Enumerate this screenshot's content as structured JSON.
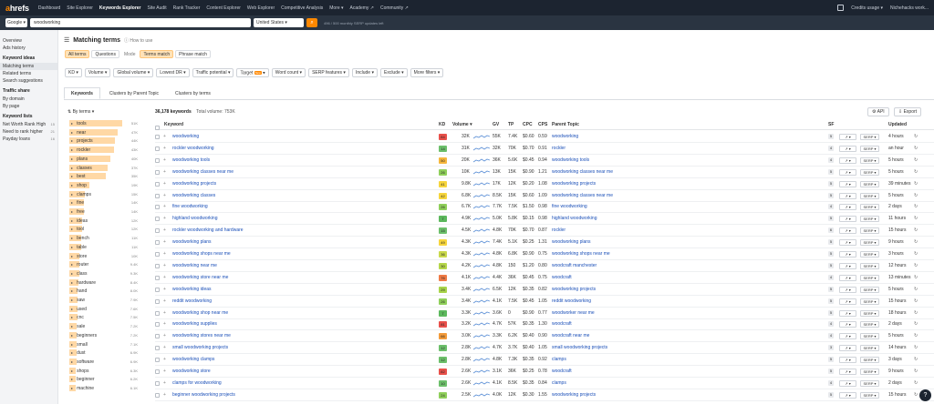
{
  "topnav": {
    "logo": "ahrefs",
    "items": [
      "Dashboard",
      "Site Explorer",
      "Keywords Explorer",
      "Site Audit",
      "Rank Tracker",
      "Content Explorer",
      "Web Explorer",
      "Competitive Analysis",
      "More ▾",
      "Academy ↗",
      "Community ↗"
    ],
    "credits": "Credits usage ▾",
    "account": "Nichehacks work..."
  },
  "search": {
    "engine": "Google ▾",
    "keyword": "woodworking",
    "country": "United States ▾",
    "quota": "496 / 500 monthly SERP updates left"
  },
  "sidebar": {
    "top": [
      {
        "label": "Overview"
      },
      {
        "label": "Ads history"
      }
    ],
    "keyword_ideas_head": "Keyword ideas",
    "keyword_ideas": [
      {
        "label": "Matching terms"
      },
      {
        "label": "Related terms"
      },
      {
        "label": "Search suggestions"
      }
    ],
    "traffic_head": "Traffic share",
    "traffic": [
      {
        "label": "By domain"
      },
      {
        "label": "By page"
      }
    ],
    "lists_head": "Keyword lists",
    "lists": [
      {
        "label": "Net Worth Rank High",
        "count": "15"
      },
      {
        "label": "Need to rank higher",
        "count": "21"
      },
      {
        "label": "Payday loans",
        "count": "16"
      }
    ]
  },
  "main": {
    "title": "Matching terms",
    "how_to": "How to use",
    "modes_left": [
      "All terms",
      "Questions"
    ],
    "mode_label": "Mode",
    "modes_right": [
      "Terms match",
      "Phrase match"
    ],
    "filters": [
      "KD ▾",
      "Volume ▾",
      "Global volume ▾",
      "Lowest DR ▾",
      "Traffic potential ▾",
      "Target",
      "Word count ▾",
      "SERP features ▾",
      "Include ▾",
      "Exclude ▾",
      "More filters ▾"
    ],
    "target_badge": "New",
    "target_arrow": "▾",
    "tabs": [
      "Keywords",
      "Clusters by Parent Topic",
      "Clusters by terms"
    ]
  },
  "terms": {
    "head": "By terms ▾",
    "items": [
      {
        "t": "tools",
        "c": "51K",
        "v": 51
      },
      {
        "t": "near",
        "c": "47K",
        "v": 47
      },
      {
        "t": "projects",
        "c": "44K",
        "v": 44
      },
      {
        "t": "rockler",
        "c": "43K",
        "v": 43
      },
      {
        "t": "plans",
        "c": "40K",
        "v": 40
      },
      {
        "t": "classes",
        "c": "37K",
        "v": 37
      },
      {
        "t": "best",
        "c": "35K",
        "v": 35
      },
      {
        "t": "shop",
        "c": "19K",
        "v": 19
      },
      {
        "t": "clamps",
        "c": "15K",
        "v": 15
      },
      {
        "t": "fine",
        "c": "14K",
        "v": 14
      },
      {
        "t": "free",
        "c": "14K",
        "v": 14
      },
      {
        "t": "ideas",
        "c": "12K",
        "v": 12
      },
      {
        "t": "tool",
        "c": "12K",
        "v": 12
      },
      {
        "t": "bench",
        "c": "11K",
        "v": 11
      },
      {
        "t": "table",
        "c": "11K",
        "v": 11
      },
      {
        "t": "store",
        "c": "10K",
        "v": 10
      },
      {
        "t": "router",
        "c": "9.4K",
        "v": 9.4
      },
      {
        "t": "class",
        "c": "9.3K",
        "v": 9.3
      },
      {
        "t": "hardware",
        "c": "8.4K",
        "v": 8.4
      },
      {
        "t": "hand",
        "c": "8.0K",
        "v": 8.0
      },
      {
        "t": "saw",
        "c": "7.9K",
        "v": 7.9
      },
      {
        "t": "used",
        "c": "7.6K",
        "v": 7.6
      },
      {
        "t": "cnc",
        "c": "7.5K",
        "v": 7.5
      },
      {
        "t": "sale",
        "c": "7.2K",
        "v": 7.2
      },
      {
        "t": "beginners",
        "c": "7.2K",
        "v": 7.2
      },
      {
        "t": "small",
        "c": "7.1K",
        "v": 7.1
      },
      {
        "t": "dust",
        "c": "6.9K",
        "v": 6.9
      },
      {
        "t": "software",
        "c": "6.9K",
        "v": 6.9
      },
      {
        "t": "shops",
        "c": "6.3K",
        "v": 6.3
      },
      {
        "t": "beginner",
        "c": "6.2K",
        "v": 6.2
      },
      {
        "t": "machine",
        "c": "6.1K",
        "v": 6.1
      }
    ]
  },
  "table": {
    "count": "36,178 keywords",
    "total_volume": "Total volume: 753K",
    "api": "API",
    "export": "Export",
    "headers": {
      "keyword": "Keyword",
      "kd": "KD",
      "volume": "Volume ▾",
      "gv": "GV",
      "tp": "TP",
      "cpc": "CPC",
      "cps": "CPS",
      "parent": "Parent Topic",
      "sf": "SF",
      "updated": "Updated"
    },
    "rows": [
      {
        "kw": "woodworking",
        "kd": "84",
        "kdc": "#e8504a",
        "vol": "32K",
        "gv": "55K",
        "tp": "7.4K",
        "cpc": "$0.60",
        "cps": "0.59",
        "parent": "woodworking",
        "sf": "5",
        "upd": "4 hours"
      },
      {
        "kw": "rockler woodworking",
        "kd": "14",
        "kdc": "#6cbf6a",
        "vol": "31K",
        "gv": "32K",
        "tp": "70K",
        "cpc": "$0.70",
        "cps": "0.91",
        "parent": "rockler",
        "sf": "4",
        "upd": "an hour"
      },
      {
        "kw": "woodworking tools",
        "kd": "50",
        "kdc": "#f6b73c",
        "vol": "20K",
        "gv": "36K",
        "tp": "5.6K",
        "cpc": "$0.45",
        "cps": "0.94",
        "parent": "woodworking tools",
        "sf": "4",
        "upd": "5 hours"
      },
      {
        "kw": "woodworking classes near me",
        "kd": "26",
        "kdc": "#8fcf5a",
        "vol": "10K",
        "gv": "13K",
        "tp": "15K",
        "cpc": "$0.90",
        "cps": "1.21",
        "parent": "woodworking classes near me",
        "sf": "5",
        "upd": "5 hours"
      },
      {
        "kw": "woodworking projects",
        "kd": "41",
        "kdc": "#f6d53c",
        "vol": "9.8K",
        "gv": "17K",
        "tp": "12K",
        "cpc": "$0.20",
        "cps": "1.08",
        "parent": "woodworking projects",
        "sf": "5",
        "upd": "39 minutes"
      },
      {
        "kw": "woodworking classes",
        "kd": "42",
        "kdc": "#f6d53c",
        "vol": "6.8K",
        "gv": "8.5K",
        "tp": "15K",
        "cpc": "$0.60",
        "cps": "1.09",
        "parent": "woodworking classes near me",
        "sf": "5",
        "upd": "5 hours"
      },
      {
        "kw": "fine woodworking",
        "kd": "26",
        "kdc": "#8fcf5a",
        "vol": "6.7K",
        "gv": "7.7K",
        "tp": "7.5K",
        "cpc": "$1.50",
        "cps": "0.98",
        "parent": "fine woodworking",
        "sf": "4",
        "upd": "2 days"
      },
      {
        "kw": "highland woodworking",
        "kd": "7",
        "kdc": "#5cb85c",
        "vol": "4.9K",
        "gv": "5.0K",
        "tp": "5.8K",
        "cpc": "$0.15",
        "cps": "0.98",
        "parent": "highland woodworking",
        "sf": "5",
        "upd": "11 hours"
      },
      {
        "kw": "rockler woodworking and hardware",
        "kd": "15",
        "kdc": "#6cbf6a",
        "vol": "4.5K",
        "gv": "4.8K",
        "tp": "70K",
        "cpc": "$0.70",
        "cps": "0.87",
        "parent": "rockler",
        "sf": "6",
        "upd": "15 hours"
      },
      {
        "kw": "woodworking plans",
        "kd": "49",
        "kdc": "#f6d53c",
        "vol": "4.3K",
        "gv": "7.4K",
        "tp": "5.1K",
        "cpc": "$0.25",
        "cps": "1.31",
        "parent": "woodworking plans",
        "sf": "5",
        "upd": "9 hours"
      },
      {
        "kw": "woodworking shops near me",
        "kd": "36",
        "kdc": "#c9d94a",
        "vol": "4.3K",
        "gv": "4.8K",
        "tp": "6.8K",
        "cpc": "$0.90",
        "cps": "0.75",
        "parent": "woodworking shops near me",
        "sf": "5",
        "upd": "3 hours"
      },
      {
        "kw": "woodworking near me",
        "kd": "30",
        "kdc": "#b5d64a",
        "vol": "4.2K",
        "gv": "4.8K",
        "tp": "150",
        "cpc": "$1.20",
        "cps": "0.80",
        "parent": "woodcraft manchester",
        "sf": "5",
        "upd": "12 hours"
      },
      {
        "kw": "woodworking store near me",
        "kd": "76",
        "kdc": "#ef7a45",
        "vol": "4.1K",
        "gv": "4.4K",
        "tp": "36K",
        "cpc": "$0.45",
        "cps": "0.75",
        "parent": "woodcraft",
        "sf": "4",
        "upd": "13 minutes"
      },
      {
        "kw": "woodworking ideas",
        "kd": "29",
        "kdc": "#a8d44a",
        "vol": "3.4K",
        "gv": "6.5K",
        "tp": "12K",
        "cpc": "$0.35",
        "cps": "0.82",
        "parent": "woodworking projects",
        "sf": "5",
        "upd": "5 hours"
      },
      {
        "kw": "reddit woodworking",
        "kd": "26",
        "kdc": "#8fcf5a",
        "vol": "3.4K",
        "gv": "4.1K",
        "tp": "7.5K",
        "cpc": "$0.45",
        "cps": "1.05",
        "parent": "reddit woodworking",
        "sf": "5",
        "upd": "15 hours"
      },
      {
        "kw": "woodworking shop near me",
        "kd": "7",
        "kdc": "#5cb85c",
        "vol": "3.3K",
        "gv": "3.6K",
        "tp": "0",
        "cpc": "$0.90",
        "cps": "0.77",
        "parent": "woodworker near me",
        "sf": "5",
        "upd": "18 hours"
      },
      {
        "kw": "woodworking supplies",
        "kd": "81",
        "kdc": "#e8504a",
        "vol": "3.2K",
        "gv": "4.7K",
        "tp": "57K",
        "cpc": "$0.35",
        "cps": "1.30",
        "parent": "woodcraft",
        "sf": "4",
        "upd": "2 days"
      },
      {
        "kw": "woodworking stores near me",
        "kd": "66",
        "kdc": "#f29a3a",
        "vol": "3.0K",
        "gv": "3.3K",
        "tp": "6.2K",
        "cpc": "$0.40",
        "cps": "0.90",
        "parent": "woodcraft near me",
        "sf": "4",
        "upd": "5 hours"
      },
      {
        "kw": "small woodworking projects",
        "kd": "12",
        "kdc": "#6cbf6a",
        "vol": "2.8K",
        "gv": "4.7K",
        "tp": "3.7K",
        "cpc": "$0.40",
        "cps": "1.05",
        "parent": "small woodworking projects",
        "sf": "3",
        "upd": "14 hours"
      },
      {
        "kw": "woodworking clamps",
        "kd": "12",
        "kdc": "#6cbf6a",
        "vol": "2.8K",
        "gv": "4.8K",
        "tp": "7.3K",
        "cpc": "$0.35",
        "cps": "0.92",
        "parent": "clamps",
        "sf": "5",
        "upd": "3 days"
      },
      {
        "kw": "woodworking store",
        "kd": "82",
        "kdc": "#e8504a",
        "vol": "2.6K",
        "gv": "3.1K",
        "tp": "36K",
        "cpc": "$0.25",
        "cps": "0.78",
        "parent": "woodcraft",
        "sf": "5",
        "upd": "9 hours"
      },
      {
        "kw": "clamps for woodworking",
        "kd": "10",
        "kdc": "#6cbf6a",
        "vol": "2.6K",
        "gv": "4.1K",
        "tp": "8.5K",
        "cpc": "$0.35",
        "cps": "0.84",
        "parent": "clamps",
        "sf": "4",
        "upd": "2 days"
      },
      {
        "kw": "beginner woodworking projects",
        "kd": "24",
        "kdc": "#8fcf5a",
        "vol": "2.5K",
        "gv": "4.0K",
        "tp": "12K",
        "cpc": "$0.30",
        "cps": "1.55",
        "parent": "woodworking projects",
        "sf": "5",
        "upd": "15 hours"
      }
    ],
    "trend_label": "↗ ▾",
    "serp_label": "SERP ▾",
    "refresh": "↻"
  },
  "help": "?"
}
